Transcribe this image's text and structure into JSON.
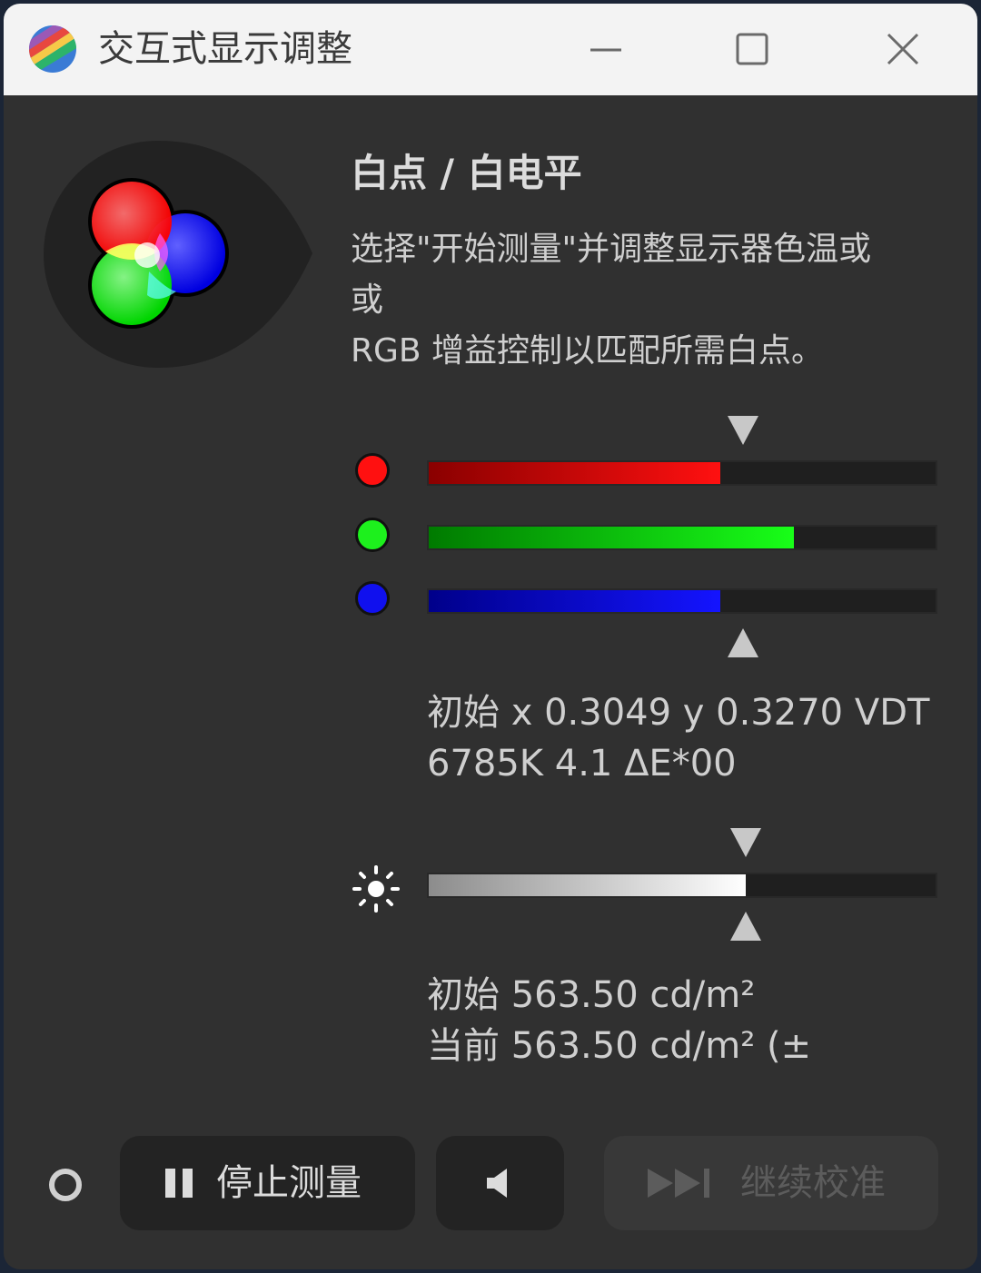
{
  "window": {
    "title": "交互式显示调整"
  },
  "header": {
    "heading": "白点 / 白电平",
    "description_lines": [
      "选择\"开始测量\"并调整显示器色温或",
      "或",
      "RGB 增益控制以匹配所需白点。"
    ]
  },
  "rgb": {
    "red": {
      "level": 0.575,
      "color": "#ff1010"
    },
    "green": {
      "level": 0.72,
      "color": "#18ff18"
    },
    "blue": {
      "level": 0.575,
      "color": "#1414ff"
    },
    "target": 0.62
  },
  "whitepoint": {
    "line1": "初始 x 0.3049 y 0.3270 VDT",
    "line2": "6785K 4.1 ΔE*00"
  },
  "luminance": {
    "level": 0.625,
    "target": 0.625,
    "line1": "初始 563.50 cd/m²",
    "line2": "当前 563.50 cd/m² (±"
  },
  "buttons": {
    "stop_label": "停止测量",
    "continue_label": "继续校准"
  }
}
